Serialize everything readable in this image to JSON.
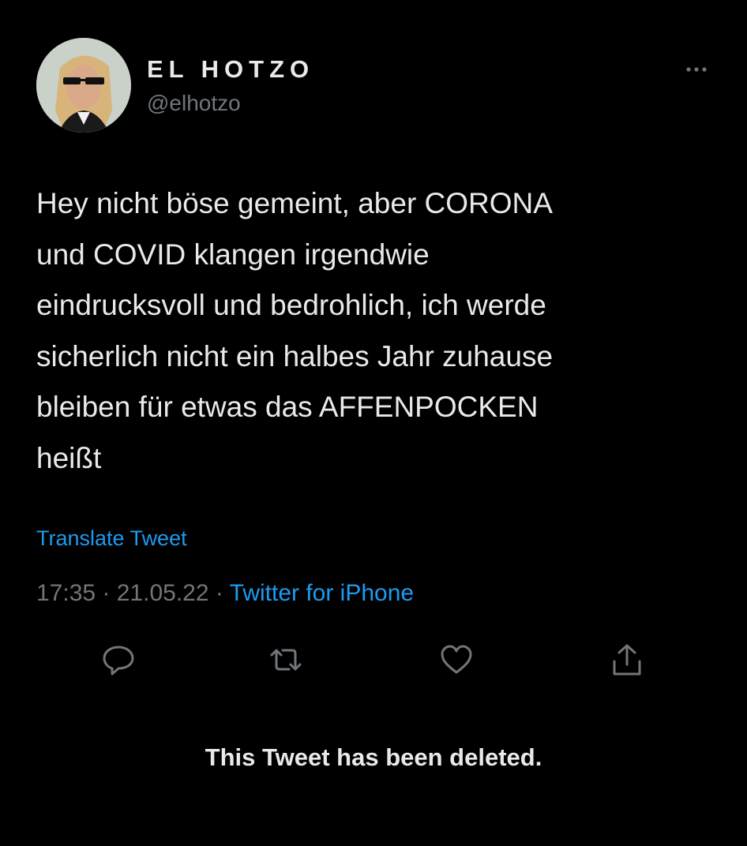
{
  "author": {
    "display_name": "EL HOTZO",
    "handle": "@elhotzo"
  },
  "tweet": {
    "text": "Hey nicht böse gemeint, aber CORONA\nund COVID klangen irgendwie\neindrucksvoll und bedrohlich, ich werde\nsicherlich nicht ein halbes Jahr zuhause\nbleiben für etwas das AFFENPOCKEN\nheißt",
    "translate_label": "Translate Tweet",
    "time": "17:35",
    "separator": " · ",
    "date": "21.05.22",
    "source": "Twitter for iPhone"
  },
  "actions": {
    "reply_icon": "reply-icon",
    "retweet_icon": "retweet-icon",
    "like_icon": "like-icon",
    "share_icon": "share-icon"
  },
  "notice": "This Tweet has been deleted.",
  "colors": {
    "background": "#000000",
    "text": "#e7e9ea",
    "secondary": "#71767b",
    "accent": "#1d9bf0"
  }
}
